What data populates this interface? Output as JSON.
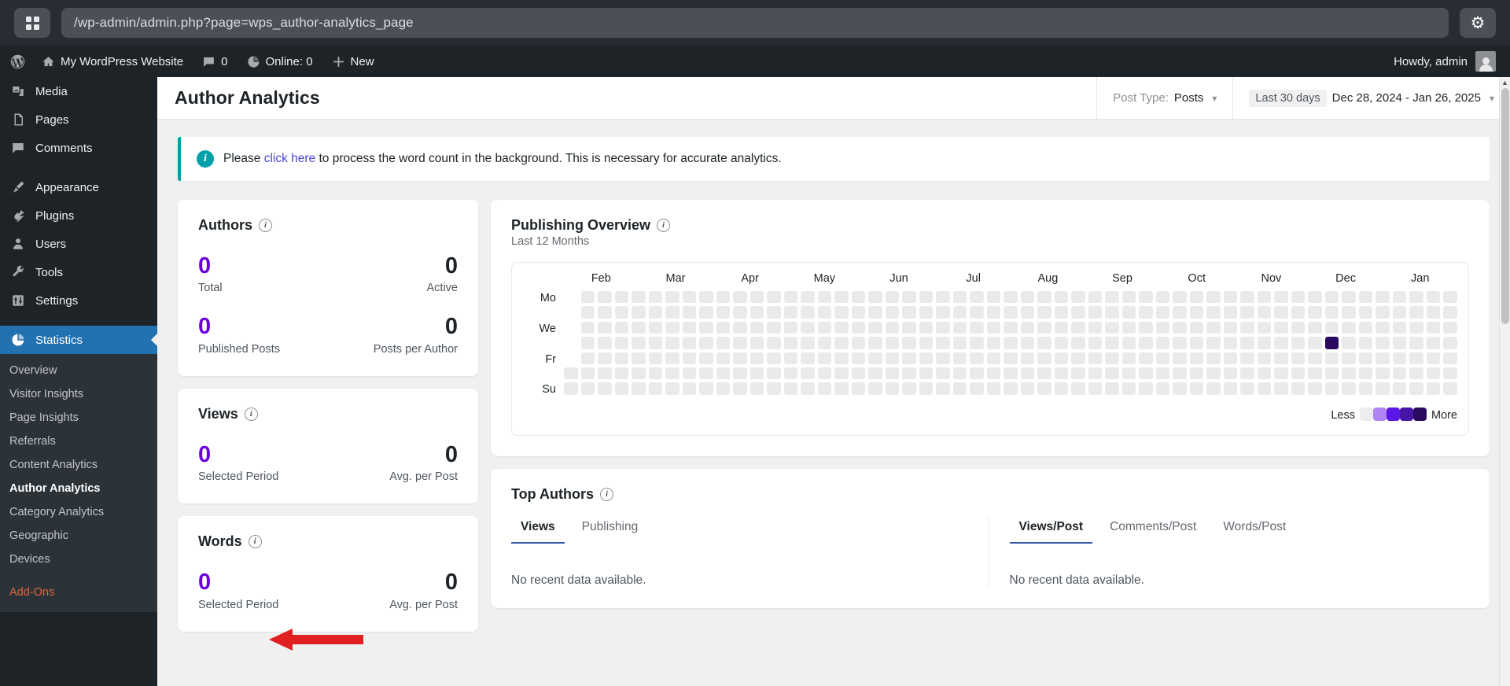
{
  "browser": {
    "apps_icon": "grid-apps-icon",
    "url": "/wp-admin/admin.php?page=wps_author-analytics_page",
    "settings_icon": "gear-icon"
  },
  "adminbar": {
    "wp_logo": "wordpress-logo-icon",
    "site_name": "My WordPress Website",
    "site_icon": "home-icon",
    "comments_icon": "comment-bubble-icon",
    "comments_count": "0",
    "online_icon": "pie-chart-icon",
    "online_label": "Online: 0",
    "new_icon": "plus-icon",
    "new_label": "New",
    "howdy": "Howdy, admin",
    "avatar": "user-avatar"
  },
  "sidebar": {
    "items": [
      {
        "label": "Media",
        "icon": "media-icon"
      },
      {
        "label": "Pages",
        "icon": "pages-icon"
      },
      {
        "label": "Comments",
        "icon": "comments-icon"
      },
      {
        "label": "Appearance",
        "icon": "paintbrush-icon"
      },
      {
        "label": "Plugins",
        "icon": "plug-icon"
      },
      {
        "label": "Users",
        "icon": "user-icon"
      },
      {
        "label": "Tools",
        "icon": "wrench-icon"
      },
      {
        "label": "Settings",
        "icon": "sliders-icon"
      },
      {
        "label": "Statistics",
        "icon": "pie-chart-icon",
        "current": true
      }
    ],
    "submenu": [
      {
        "label": "Overview"
      },
      {
        "label": "Visitor Insights"
      },
      {
        "label": "Page Insights"
      },
      {
        "label": "Referrals"
      },
      {
        "label": "Content Analytics"
      },
      {
        "label": "Author Analytics",
        "current": true
      },
      {
        "label": "Category Analytics"
      },
      {
        "label": "Geographic"
      },
      {
        "label": "Devices"
      },
      {
        "label": "Add-Ons",
        "highlight": true
      }
    ]
  },
  "header": {
    "title": "Author Analytics",
    "post_type_label": "Post Type:",
    "post_type_value": "Posts",
    "date_preset": "Last 30 days",
    "date_range": "Dec 28, 2024 - Jan 26, 2025",
    "chevron_icon": "chevron-down-icon"
  },
  "notice": {
    "icon": "info-icon",
    "prefix": "Please ",
    "link": "click here",
    "suffix": " to process the word count in the background. This is necessary for accurate analytics."
  },
  "cards": {
    "authors": {
      "title": "Authors",
      "info_icon": "info-icon",
      "stats": [
        {
          "value": "0",
          "label": "Total",
          "accent": true
        },
        {
          "value": "0",
          "label": "Active",
          "accent": false
        },
        {
          "value": "0",
          "label": "Published Posts",
          "accent": true
        },
        {
          "value": "0",
          "label": "Posts per Author",
          "accent": false
        }
      ]
    },
    "views": {
      "title": "Views",
      "info_icon": "info-icon",
      "stats": [
        {
          "value": "0",
          "label": "Selected Period",
          "accent": true
        },
        {
          "value": "0",
          "label": "Avg. per Post",
          "accent": false
        }
      ]
    },
    "words": {
      "title": "Words",
      "info_icon": "info-icon",
      "stats": [
        {
          "value": "0",
          "label": "Selected Period",
          "accent": true
        },
        {
          "value": "0",
          "label": "Avg. per Post",
          "accent": false
        }
      ]
    },
    "publishing_overview": {
      "title": "Publishing Overview",
      "info_icon": "info-icon",
      "subtitle": "Last 12 Months",
      "legend_less": "Less",
      "legend_more": "More"
    },
    "top_authors": {
      "title": "Top Authors",
      "info_icon": "info-icon",
      "left_tabs": [
        "Views",
        "Publishing"
      ],
      "left_active_tab": "Views",
      "left_empty": "No recent data available.",
      "right_tabs": [
        "Views/Post",
        "Comments/Post",
        "Words/Post"
      ],
      "right_active_tab": "Views/Post",
      "right_empty": "No recent data available."
    }
  },
  "chart_data": {
    "type": "heatmap",
    "title": "Publishing Overview",
    "subtitle": "Last 12 Months",
    "xlabel": "",
    "ylabel": "",
    "month_labels": [
      "Feb",
      "Mar",
      "Apr",
      "May",
      "Jun",
      "Jul",
      "Aug",
      "Sep",
      "Oct",
      "Nov",
      "Dec",
      "Jan"
    ],
    "day_labels": [
      "Mo",
      "",
      "We",
      "",
      "Fr",
      "",
      "Su"
    ],
    "weeks": 53,
    "days_per_week": 7,
    "leading_empty_cells": 5,
    "legend": {
      "less": "Less",
      "more": "More",
      "colors": [
        "#ebedef",
        "#b084f5",
        "#5c16e8",
        "#4516a8",
        "#2a0a5e"
      ]
    },
    "grid": false,
    "values_note": "All cells level 0 (no posts) except one cell at level 4",
    "highlighted_cells": [
      {
        "week_index": 45,
        "day_index": 3,
        "level": 4,
        "color": "#2a0a5e"
      }
    ]
  },
  "colors": {
    "accent_purple": "#6c00e0",
    "wp_blue": "#2271b1",
    "notice_teal": "#00a0a8",
    "link_purple": "#4a47d5",
    "tab_underline": "#3858a8",
    "addons_orange": "#e2663b"
  }
}
